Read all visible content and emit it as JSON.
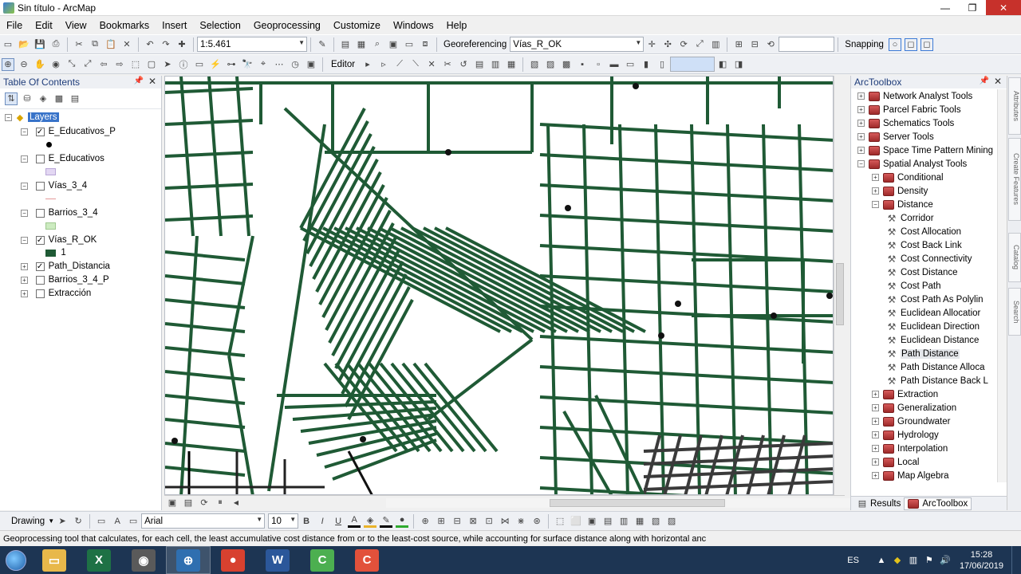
{
  "window": {
    "title": "Sin título - ArcMap",
    "min": "—",
    "max": "❐",
    "close": "✕"
  },
  "menu": [
    "File",
    "Edit",
    "View",
    "Bookmarks",
    "Insert",
    "Selection",
    "Geoprocessing",
    "Customize",
    "Windows",
    "Help"
  ],
  "toolbar": {
    "scale": "1:5.461",
    "georeferencing": "Georeferencing",
    "georef_layer": "Vías_R_OK",
    "snapping": "Snapping",
    "editor": "Editor"
  },
  "toc": {
    "title": "Table Of Contents",
    "root": "Layers",
    "layers": [
      {
        "name": "E_Educativos_P",
        "checked": true,
        "expander": "⊟",
        "legend": "dot"
      },
      {
        "name": "E_Educativos",
        "checked": false,
        "expander": "⊟",
        "legend": "purple"
      },
      {
        "name": "Vías_3_4",
        "checked": false,
        "expander": "⊟",
        "legend": "line"
      },
      {
        "name": "Barrios_3_4",
        "checked": false,
        "expander": "⊟",
        "legend": "green"
      },
      {
        "name": "Vías_R_OK",
        "checked": true,
        "expander": "⊟",
        "legend": "dark",
        "legend_label": "1"
      },
      {
        "name": "Path_Distancia",
        "checked": true,
        "expander": "⊞"
      },
      {
        "name": "Barrios_3_4_P",
        "checked": false,
        "expander": "⊞"
      },
      {
        "name": "Extracción",
        "checked": false,
        "expander": "⊞"
      }
    ],
    "colors": {
      "purple": "#e3d7f3",
      "line": "#e49999",
      "green": "#ccebc0",
      "dark": "#1f5a35"
    }
  },
  "map": {
    "road_color": "#1f5a35",
    "dark_road_color": "#3a3a3a"
  },
  "arctoolbox": {
    "title": "ArcToolbox",
    "items": [
      {
        "label": "Network Analyst Tools",
        "level": 0,
        "kind": "toolbox",
        "exp": "+"
      },
      {
        "label": "Parcel Fabric Tools",
        "level": 0,
        "kind": "toolbox",
        "exp": "+"
      },
      {
        "label": "Schematics Tools",
        "level": 0,
        "kind": "toolbox",
        "exp": "+"
      },
      {
        "label": "Server Tools",
        "level": 0,
        "kind": "toolbox",
        "exp": "+"
      },
      {
        "label": "Space Time Pattern Mining",
        "level": 0,
        "kind": "toolbox",
        "exp": "+"
      },
      {
        "label": "Spatial Analyst Tools",
        "level": 0,
        "kind": "toolbox",
        "exp": "−"
      },
      {
        "label": "Conditional",
        "level": 1,
        "kind": "toolbox",
        "exp": "+"
      },
      {
        "label": "Density",
        "level": 1,
        "kind": "toolbox",
        "exp": "+"
      },
      {
        "label": "Distance",
        "level": 1,
        "kind": "toolbox",
        "exp": "−"
      },
      {
        "label": "Corridor",
        "level": 2,
        "kind": "tool"
      },
      {
        "label": "Cost Allocation",
        "level": 2,
        "kind": "tool"
      },
      {
        "label": "Cost Back Link",
        "level": 2,
        "kind": "tool"
      },
      {
        "label": "Cost Connectivity",
        "level": 2,
        "kind": "tool"
      },
      {
        "label": "Cost Distance",
        "level": 2,
        "kind": "tool"
      },
      {
        "label": "Cost Path",
        "level": 2,
        "kind": "tool"
      },
      {
        "label": "Cost Path As Polylin",
        "level": 2,
        "kind": "tool"
      },
      {
        "label": "Euclidean Allocatior",
        "level": 2,
        "kind": "tool"
      },
      {
        "label": "Euclidean Direction",
        "level": 2,
        "kind": "tool"
      },
      {
        "label": "Euclidean Distance",
        "level": 2,
        "kind": "tool"
      },
      {
        "label": "Path Distance",
        "level": 2,
        "kind": "tool",
        "selected": true
      },
      {
        "label": "Path Distance Alloca",
        "level": 2,
        "kind": "tool"
      },
      {
        "label": "Path Distance Back L",
        "level": 2,
        "kind": "tool"
      },
      {
        "label": "Extraction",
        "level": 1,
        "kind": "toolbox",
        "exp": "+"
      },
      {
        "label": "Generalization",
        "level": 1,
        "kind": "toolbox",
        "exp": "+"
      },
      {
        "label": "Groundwater",
        "level": 1,
        "kind": "toolbox",
        "exp": "+"
      },
      {
        "label": "Hydrology",
        "level": 1,
        "kind": "toolbox",
        "exp": "+"
      },
      {
        "label": "Interpolation",
        "level": 1,
        "kind": "toolbox",
        "exp": "+"
      },
      {
        "label": "Local",
        "level": 1,
        "kind": "toolbox",
        "exp": "+"
      },
      {
        "label": "Map Algebra",
        "level": 1,
        "kind": "toolbox",
        "exp": "+"
      }
    ],
    "tabs": [
      "Results",
      "ArcToolbox"
    ]
  },
  "right_dock": [
    "Attributes",
    "Create Features",
    "Catalog",
    "Search"
  ],
  "drawing": {
    "label": "Drawing",
    "font": "Arial",
    "size": "10"
  },
  "status": "Geoprocessing tool that calculates, for each cell, the least accumulative cost distance from or to the least-cost source, while accounting for surface distance along with horizontal anc",
  "tray": {
    "lang": "ES",
    "time": "15:28",
    "date": "17/06/2019"
  },
  "taskbar": [
    {
      "name": "windows-explorer",
      "color": "#e8b84a",
      "glyph": "▭"
    },
    {
      "name": "excel",
      "color": "#1e7145",
      "glyph": "X"
    },
    {
      "name": "arcgis-pro",
      "color": "#5a5a5a",
      "glyph": "◉"
    },
    {
      "name": "arcmap",
      "color": "#2f6fb0",
      "glyph": "⊕",
      "active": true
    },
    {
      "name": "chrome",
      "color": "#d8412f",
      "glyph": "●"
    },
    {
      "name": "word",
      "color": "#2b579a",
      "glyph": "W"
    },
    {
      "name": "camtasia-green",
      "color": "#4caf50",
      "glyph": "C"
    },
    {
      "name": "camtasia-red",
      "color": "#e2513b",
      "glyph": "C"
    }
  ]
}
